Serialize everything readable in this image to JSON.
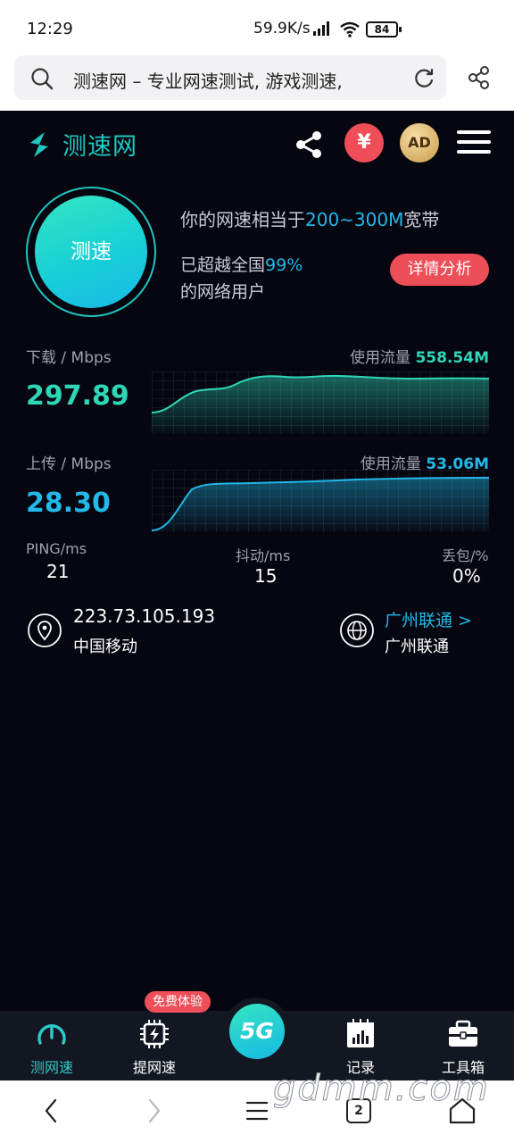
{
  "status_bar": {
    "time": "12:29",
    "net_speed": "59.9K/s",
    "battery": "84"
  },
  "address_bar": {
    "title": "测速网 – 专业网速测试, 游戏测速,"
  },
  "app": {
    "brand": "测速网",
    "header_icons": {
      "yen": "¥",
      "ad": "AD"
    },
    "test_button": "测速",
    "summary": {
      "prefix": "你的网速相当于",
      "bandwidth": "200~300M",
      "suffix": "宽带",
      "beat_prefix": "已超越全国",
      "beat_pct": "99%",
      "beat_suffix": "的网络用户",
      "detail_button": "详情分析"
    },
    "download": {
      "label": "下载 / Mbps",
      "value": "297.89",
      "usage_label": "使用流量",
      "usage": "558.54M"
    },
    "upload": {
      "label": "上传 / Mbps",
      "value": "28.30",
      "usage_label": "使用流量",
      "usage": "53.06M"
    },
    "stats": {
      "ping_label": "PING/ms",
      "ping": "21",
      "jitter_label": "抖动/ms",
      "jitter": "15",
      "loss_label": "丢包/%",
      "loss": "0%"
    },
    "ip": {
      "address": "223.73.105.193",
      "isp": "中国移动"
    },
    "server": {
      "link": "广州联通 >",
      "node": "广州联通"
    },
    "colors": {
      "download": "#2fd6b8",
      "upload": "#22b8e8",
      "accent_red": "#ee4e58"
    }
  },
  "app_nav": {
    "items": [
      "测网速",
      "提网速",
      "记录",
      "工具箱"
    ],
    "badge": "免费体验",
    "center": "5G"
  },
  "watermark": "gdmm.com",
  "browser_bar": {
    "tabs_count": "2"
  }
}
